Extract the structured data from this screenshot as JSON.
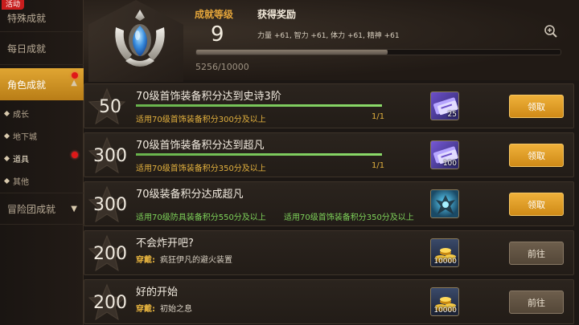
{
  "sidebar": {
    "event_badge": "活动",
    "items": [
      {
        "label": "特殊成就"
      },
      {
        "label": "每日成就"
      },
      {
        "label": "角色成就"
      },
      {
        "label": "冒险团成就"
      }
    ],
    "sub_items": [
      {
        "label": "成长"
      },
      {
        "label": "地下城"
      },
      {
        "label": "道具"
      },
      {
        "label": "其他"
      }
    ]
  },
  "header": {
    "level_label": "成就等级",
    "level_value": "9",
    "reward_label": "获得奖励",
    "reward_stats": "力量 +61, 智力 +61, 体力 +61, 精神 +61",
    "progress_text": "5256/10000",
    "progress_fraction": 0.5256
  },
  "rows": [
    {
      "points": "50",
      "title": "70级首饰装备积分达到史诗3阶",
      "desc": "适用70级首饰装备积分300分及以上",
      "ratio": "1/1",
      "bar_fraction": 1.0,
      "item_count": "25",
      "item_icon": "ticket-icon",
      "button": "领取"
    },
    {
      "points": "300",
      "title": "70级首饰装备积分达到超凡",
      "desc": "适用70级首饰装备积分350分及以上",
      "ratio": "1/1",
      "bar_fraction": 1.0,
      "item_count": "100",
      "item_icon": "ticket-icon",
      "button": "领取"
    },
    {
      "points": "300",
      "title": "70级装备积分达成超凡",
      "desc_left": "适用70级防具装备积分550分及以上",
      "desc_right": "适用70级首饰装备积分350分及以上",
      "item_icon": "creature-icon",
      "button": "领取"
    },
    {
      "points": "200",
      "title": "不会炸开吧?",
      "desc_key": "穿戴:",
      "desc_val": "疯狂伊凡的避火装置",
      "item_count": "10000",
      "item_icon": "gold-coins-icon",
      "button": "前往"
    },
    {
      "points": "200",
      "title": "好的开始",
      "desc_key": "穿戴:",
      "desc_val": "初始之息",
      "item_count": "10000",
      "item_icon": "gold-coins-icon",
      "button": "前往"
    }
  ],
  "colors": {
    "accent_gold": "#e4a53a",
    "claim_button": "#e39f2a",
    "goto_button": "#62543f",
    "progress_green": "#7ed35a",
    "notification_red": "#e01818"
  }
}
